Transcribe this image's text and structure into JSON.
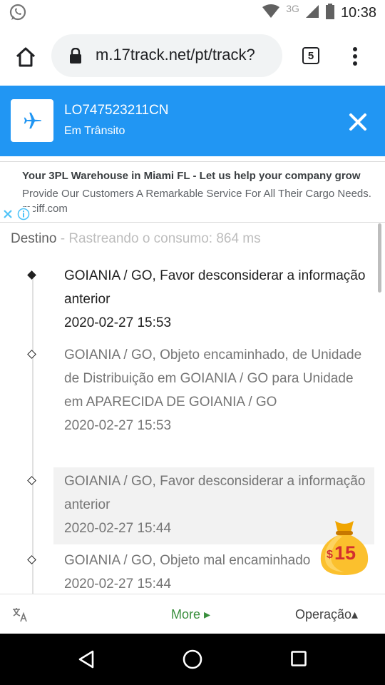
{
  "status_bar": {
    "network": "3G",
    "time": "10:38"
  },
  "browser": {
    "url": "m.17track.net/pt/track?",
    "tab_count": "5"
  },
  "tracking": {
    "number": "LO747523211CN",
    "status": "Em Trânsito"
  },
  "ad": {
    "title": "Your 3PL Warehouse in Miami FL - Let us help your company grow",
    "body": "Provide Our Customers A Remarkable Service For All Their Cargo Needs. mciff.com"
  },
  "destination": {
    "label": "Destino",
    "separator": " - ",
    "timing": "Rastreando o consumo: 864 ms"
  },
  "events": [
    {
      "description": "GOIANIA / GO, Favor desconsiderar a informação anterior",
      "datetime": "2020-02-27 15:53"
    },
    {
      "description": "GOIANIA / GO, Objeto encaminhado, de Unidade de Distribuição em GOIANIA / GO para Unidade em APARECIDA DE GOIANIA / GO",
      "datetime": "2020-02-27 15:53"
    },
    {
      "description": "GOIANIA / GO, Favor desconsiderar a informação anterior",
      "datetime": "2020-02-27 15:44"
    },
    {
      "description": "GOIANIA / GO, Objeto mal encaminhado",
      "datetime": "2020-02-27 15:44"
    }
  ],
  "reward": {
    "amount_symbol": "$",
    "amount_value": "15"
  },
  "toolbar": {
    "more_label": "More ▸",
    "operation_label": "Operação▴"
  },
  "colors": {
    "header_blue": "#2196f3",
    "more_green": "#388e3c",
    "ad_icon_blue": "#4fc3f7"
  }
}
